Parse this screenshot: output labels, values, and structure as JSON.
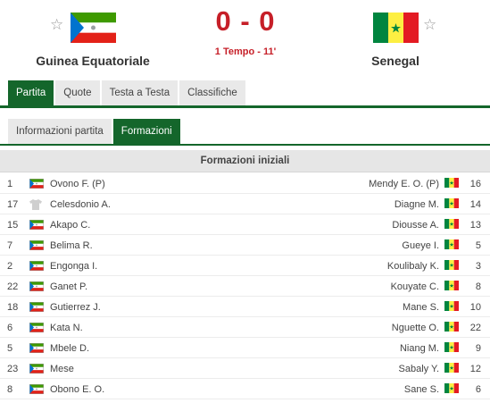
{
  "match": {
    "home_team": "Guinea Equatoriale",
    "away_team": "Senegal",
    "score": "0 - 0",
    "status": "1 Tempo - 11'",
    "home_flag": "equatorial-guinea-flag",
    "away_flag": "senegal-flag"
  },
  "colors": {
    "accent": "#14662b",
    "score": "#c61f28",
    "tab_inactive": "#e9e9e9"
  },
  "main_tabs": [
    "Partita",
    "Quote",
    "Testa a Testa",
    "Classifiche"
  ],
  "sub_tabs": [
    "Informazioni partita",
    "Formazioni"
  ],
  "lineup": {
    "title": "Formazioni iniziali",
    "home": [
      {
        "number": "1",
        "name": "Ovono F. (P)",
        "icon": "flag"
      },
      {
        "number": "17",
        "name": "Celesdonio A.",
        "icon": "shirt"
      },
      {
        "number": "15",
        "name": "Akapo C.",
        "icon": "flag"
      },
      {
        "number": "7",
        "name": "Belima R.",
        "icon": "flag"
      },
      {
        "number": "2",
        "name": "Engonga I.",
        "icon": "flag"
      },
      {
        "number": "22",
        "name": "Ganet P.",
        "icon": "flag"
      },
      {
        "number": "18",
        "name": "Gutierrez J.",
        "icon": "flag"
      },
      {
        "number": "6",
        "name": "Kata N.",
        "icon": "flag"
      },
      {
        "number": "5",
        "name": "Mbele D.",
        "icon": "flag"
      },
      {
        "number": "23",
        "name": "Mese",
        "icon": "flag"
      },
      {
        "number": "8",
        "name": "Obono E. O.",
        "icon": "flag"
      }
    ],
    "away": [
      {
        "number": "16",
        "name": "Mendy E. O. (P)"
      },
      {
        "number": "14",
        "name": "Diagne M."
      },
      {
        "number": "13",
        "name": "Diousse A."
      },
      {
        "number": "5",
        "name": "Gueye I."
      },
      {
        "number": "3",
        "name": "Koulibaly K."
      },
      {
        "number": "8",
        "name": "Kouyate C."
      },
      {
        "number": "10",
        "name": "Mane S."
      },
      {
        "number": "22",
        "name": "Nguette O."
      },
      {
        "number": "9",
        "name": "Niang M."
      },
      {
        "number": "12",
        "name": "Sabaly Y."
      },
      {
        "number": "6",
        "name": "Sane S."
      }
    ]
  }
}
